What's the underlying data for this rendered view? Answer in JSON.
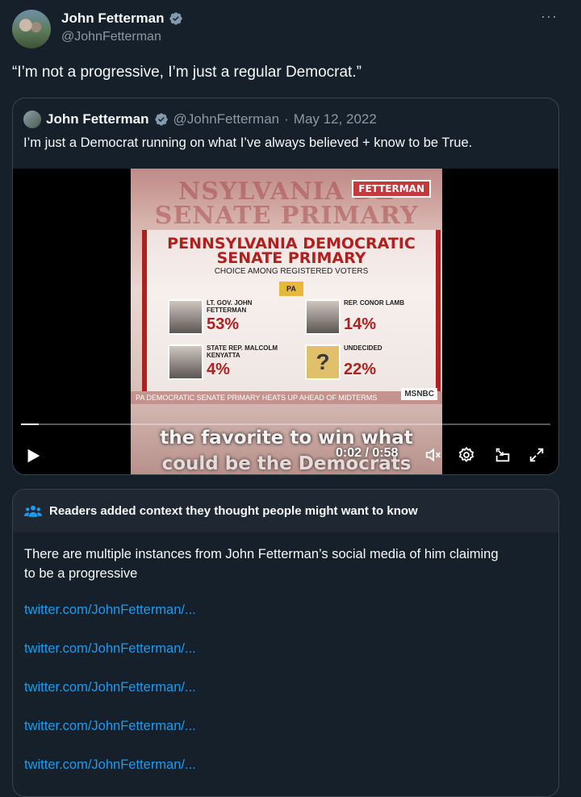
{
  "author": {
    "name": "John Fetterman",
    "handle": "@JohnFetterman"
  },
  "tweet": {
    "text": "“I’m not a progressive, I’m just a regular Democrat.”",
    "more_label": "···"
  },
  "quoted_tweet": {
    "author_name": "John Fetterman",
    "handle": "@JohnFetterman",
    "separator": "·",
    "date": "May 12, 2022",
    "text": "I’m just a Democrat running on what I’ve always believed + know to be True."
  },
  "video": {
    "graphic": {
      "ghost_title": "NSYLVANIA DE SENATE PRIMARY",
      "logo": "FETTERMAN",
      "title_line1": "PENNSYLVANIA DEMOCRATIC",
      "title_line2": "SENATE PRIMARY",
      "subtitle": "CHOICE AMONG REGISTERED VOTERS",
      "region": "PA",
      "candidates": [
        {
          "role": "LT. GOV. JOHN FETTERMAN",
          "pct": "53%"
        },
        {
          "role": "REP. CONOR LAMB",
          "pct": "14%"
        },
        {
          "role": "STATE REP. MALCOLM KENYATTA",
          "pct": "4%"
        },
        {
          "role": "UNDECIDED",
          "pct": "22%"
        }
      ],
      "undecided_mark": "?",
      "ticker": "PA DEMOCRATIC SENATE PRIMARY HEATS UP AHEAD OF MIDTERMS",
      "network": "MSNBC"
    },
    "caption_line1": "the favorite to win what",
    "caption_line2": "could be the Democrats",
    "timecode": "0:02 / 0:58",
    "progress": 0.034
  },
  "community_note": {
    "title": "Readers added context they thought people might want to know",
    "body": "There are multiple instances from John Fetterman’s social media of him claiming to be a progressive",
    "links": [
      "twitter.com/JohnFetterman/...",
      "twitter.com/JohnFetterman/...",
      "twitter.com/JohnFetterman/...",
      "twitter.com/JohnFetterman/...",
      "twitter.com/JohnFetterman/..."
    ]
  },
  "colors": {
    "background": "#15202b",
    "link": "#1d9bf0",
    "muted": "#8b98a5",
    "verified": "#829aab"
  }
}
